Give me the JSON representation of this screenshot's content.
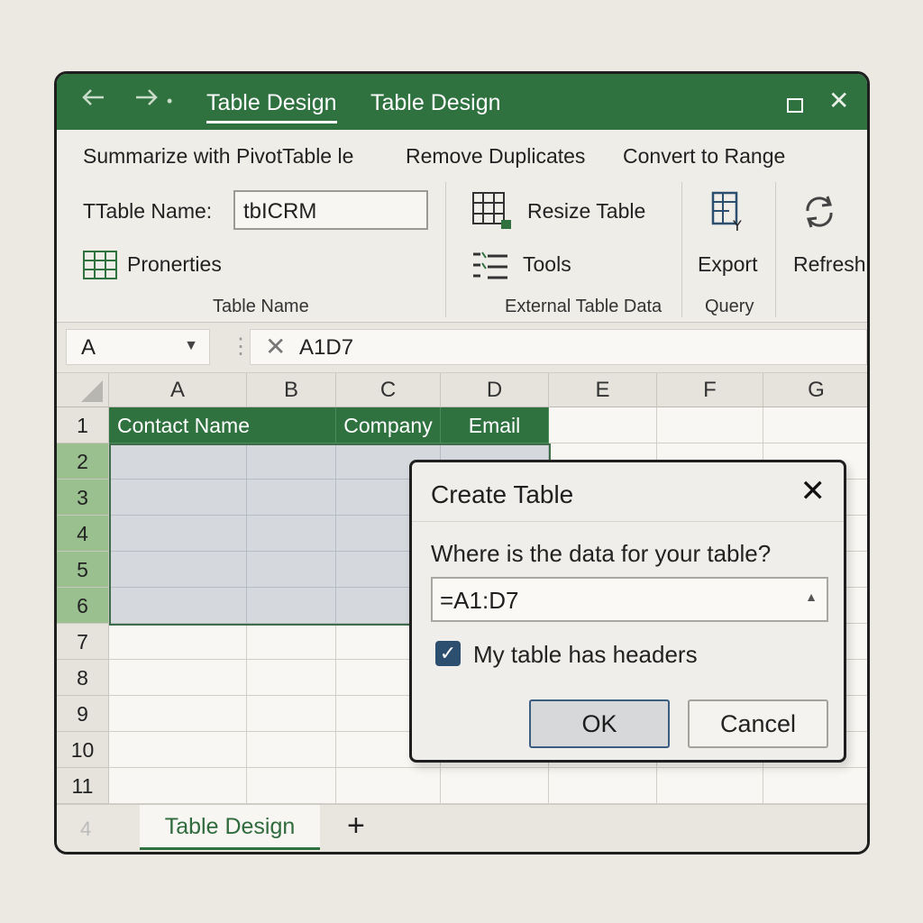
{
  "titlebar": {
    "back_icon": "arrow-left-icon",
    "forward_icon": "arrow-right-icon",
    "forward_dot": "•",
    "tab_active": "Table Design",
    "tab_second": "Table Design",
    "maximize_icon": "square-icon",
    "close_icon": "close-icon",
    "close_glyph": "✕"
  },
  "ribbon": {
    "tools_row": {
      "summarize": "Summarize with PivotTable le",
      "remove_duplicates": "Remove Duplicates",
      "convert_to_range": "Convert to Range"
    },
    "properties": {
      "table_name_label": "TTable Name:",
      "table_name_value": "tbICRM",
      "properties_label": "Pronerties",
      "group_label": "Table Name"
    },
    "external": {
      "resize_table": "Resize Table",
      "tools": "Tools",
      "group_label": "External Table Data"
    },
    "query": {
      "export": "Export",
      "group_label": "Query"
    },
    "refresh": {
      "label": "Refresh"
    }
  },
  "formula_bar": {
    "name_box": "A",
    "dropdown_glyph": "▼",
    "separator": "⋮",
    "cancel_glyph": "✕",
    "formula": "A1D7"
  },
  "grid": {
    "columns": [
      "A",
      "B",
      "C",
      "D",
      "E",
      "F",
      "G"
    ],
    "rows": [
      "1",
      "2",
      "3",
      "4",
      "5",
      "6",
      "7",
      "8",
      "9",
      "10",
      "11"
    ],
    "headers": [
      "Contact Name",
      "Company",
      "Email"
    ]
  },
  "sheet_bar": {
    "sheet_number": "4",
    "tab": "Table Design",
    "add_glyph": "+"
  },
  "dialog": {
    "title": "Create Table",
    "close_glyph": "✕",
    "question": "Where is the data for your table?",
    "range_value": "=A1:D7",
    "range_icon": "▲",
    "checkbox_checked": true,
    "checkbox_glyph": "✓",
    "checkbox_label": "My table has headers",
    "ok": "OK",
    "cancel": "Cancel"
  },
  "colors": {
    "accent_green": "#2f7240",
    "selection_blue": "#d5d8dd",
    "row_header_selected": "#9bc08f"
  }
}
